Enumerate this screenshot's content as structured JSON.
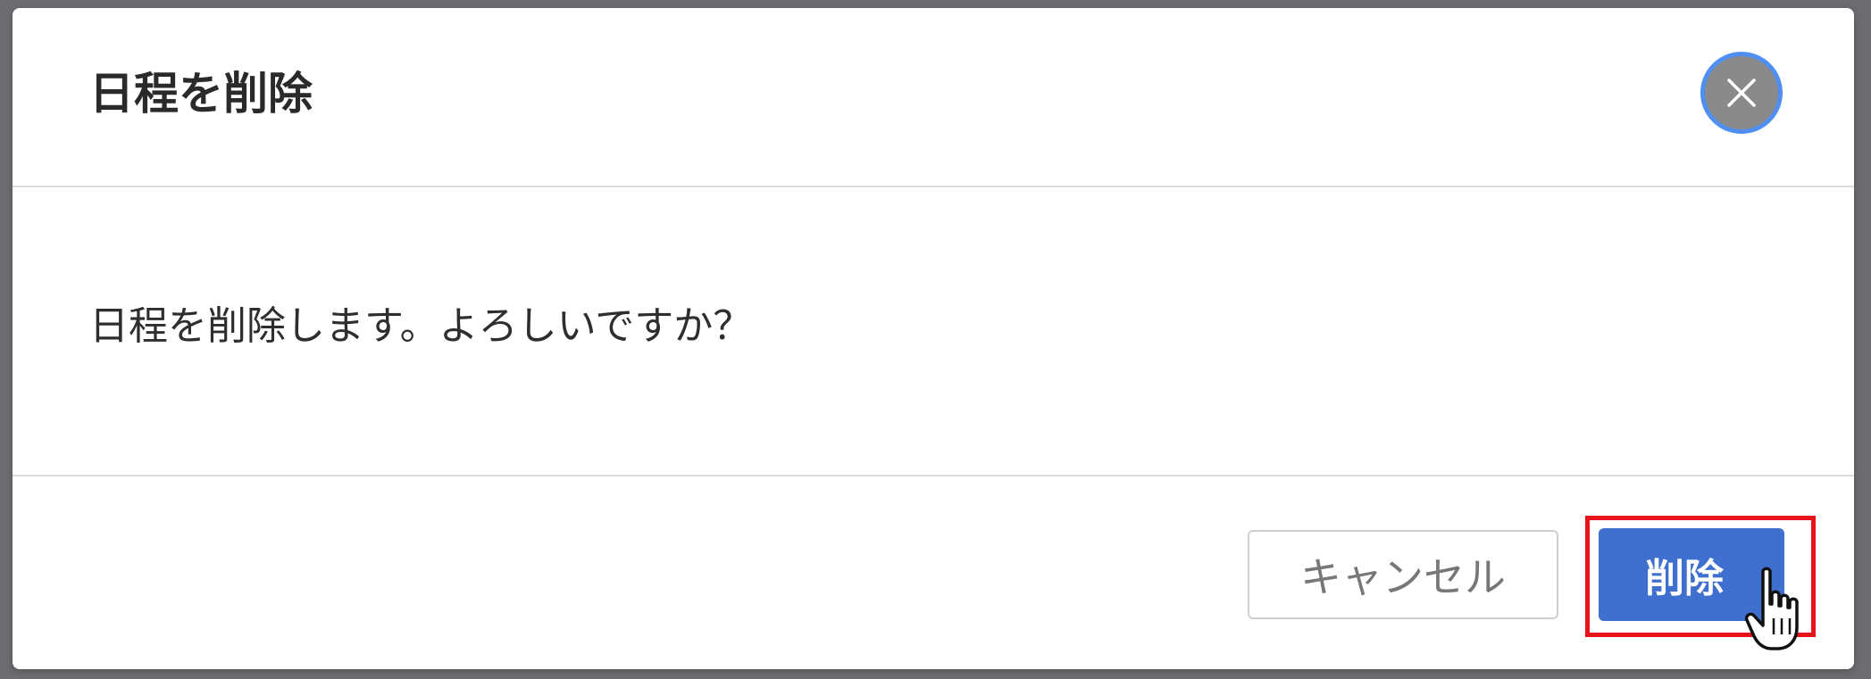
{
  "dialog": {
    "title": "日程を削除",
    "message": "日程を削除します。よろしいですか？",
    "close_icon": "close-icon",
    "cancel_label": "キャンセル",
    "delete_label": "削除"
  },
  "colors": {
    "backdrop": "#6d6d71",
    "primary_button": "#3f6fcf",
    "close_button": "#8a8a8a",
    "focus_ring": "#4f8ff2",
    "highlight": "#e8141c"
  },
  "cursor": "hand-pointer-icon"
}
